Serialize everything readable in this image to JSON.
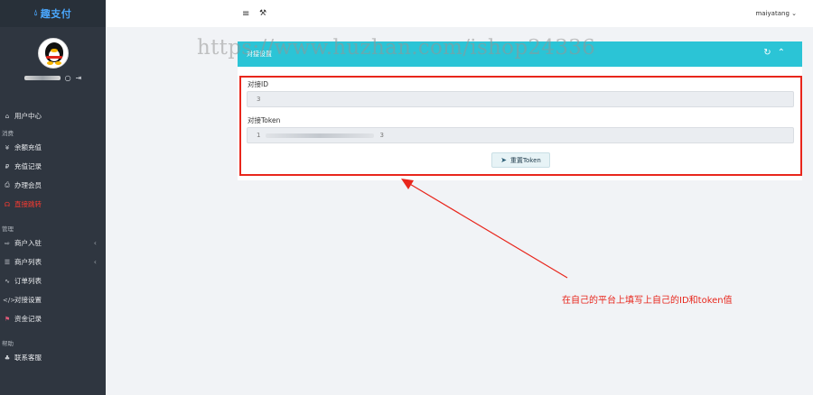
{
  "brand": {
    "icon": "brand-drop-icon",
    "name": "趣支付"
  },
  "profile": {
    "avatar": "qq-penguin-avatar",
    "icons": [
      "drop-icon",
      "logout-icon"
    ]
  },
  "sidebar": {
    "user_center": "用户中心",
    "section_consume": "消费",
    "consume_items": [
      "余额充值",
      "充值记录",
      "办理会员",
      "直接跳转"
    ],
    "section_manage": "管理",
    "manage_items": [
      "商户入驻",
      "商户列表",
      "订单列表",
      "对接设置",
      "资金记录"
    ],
    "section_help": "帮助",
    "help_items": [
      "联系客服"
    ]
  },
  "topbar": {
    "username": "maiyatang",
    "menu_icon": "hamburger-icon",
    "tool_icon": "wrench-icon"
  },
  "watermark": "https://www.huzhan.com/ishop24336",
  "panel": {
    "title": "对接设置",
    "id_label": "对接ID",
    "id_value": "3",
    "token_label": "对接Token",
    "token_value_start": "1",
    "token_value_end": "3",
    "reset_button": "重置Token"
  },
  "annotation": {
    "text": "在自己的平台上填写上自己的ID和token值",
    "color": "#e8261c"
  },
  "colors": {
    "sidebar": "#2f3640",
    "panel_header": "#2bc4d6",
    "highlight": "#e8261c",
    "active_nav": "#ff3b30"
  }
}
